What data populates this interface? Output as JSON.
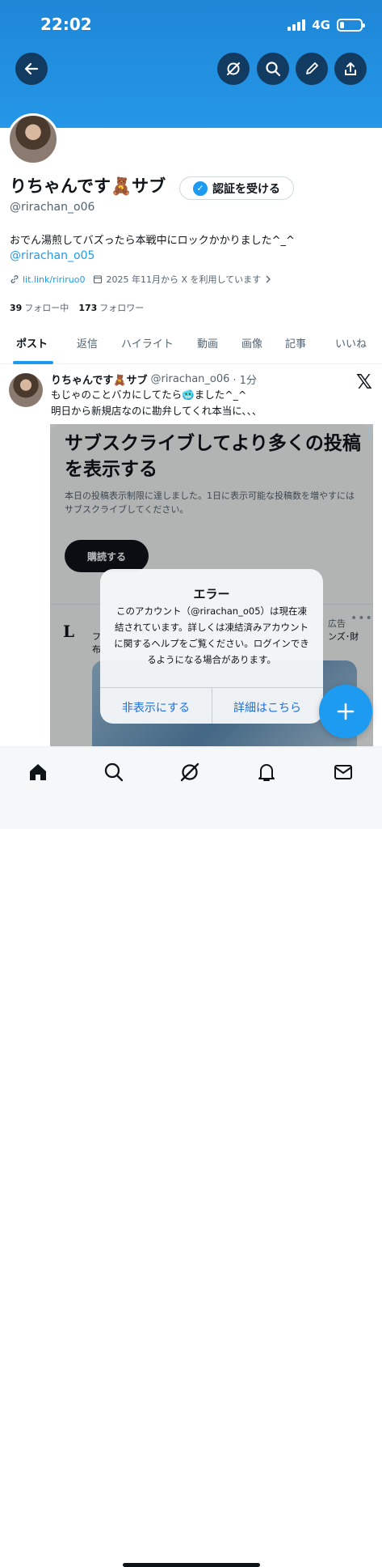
{
  "status": {
    "time": "22:02",
    "network": "4G",
    "battery_level": 0.2
  },
  "header": {
    "back_icon": "arrow-left-icon",
    "actions": [
      "grok-icon",
      "search-icon",
      "edit-icon",
      "share-icon"
    ]
  },
  "profile": {
    "display_name": "りちゃんです🧸サブ",
    "verify_label": "認証を受ける",
    "handle": "@rirachan_o06",
    "bio": "おでん湯煎してバズったら本戦中にロックかかりました^_^",
    "bio_link": "@rirachan_o05",
    "website": "lit.link/ririruo0",
    "joined": "2025 年11月から X を利用しています",
    "following_count": "39",
    "following_label": "フォロー中",
    "followers_count": "173",
    "followers_label": "フォロワー"
  },
  "tabs": [
    "ポスト",
    "返信",
    "ハイライト",
    "動画",
    "画像",
    "記事",
    "いいね"
  ],
  "post": {
    "name": "りちゃんです🧸サブ",
    "handle": "@rirachan_o06",
    "time": "· 1分",
    "line1": "もじゃのことバカにしてたら🥶ました^_^",
    "line2": "明日から新規店なのに勘弁してくれ本当に、、、"
  },
  "subscribe": {
    "title": "サブスクライブしてより多くの投稿を表示する",
    "description": "本日の投稿表示制限に達しました。1日に表示可能な投稿数を増やすにはサブスクライブしてください。",
    "button": "購読する"
  },
  "ad": {
    "brand_initial": "L",
    "prefix_1": "フ",
    "prefix_2": "布",
    "label": "広告",
    "more": "•••",
    "text": "ンズ･財"
  },
  "dialog": {
    "title": "エラー",
    "body": "このアカウント（@rirachan_o05）は現在凍結されています。詳しくは凍結済みアカウントに関するヘルプをご覧ください。ログインできるようになる場合があります。",
    "hide_button": "非表示にする",
    "details_button": "詳細はこちら"
  },
  "nav": [
    "home-icon",
    "search-icon",
    "grok-icon",
    "notifications-icon",
    "messages-icon"
  ],
  "colors": {
    "accent": "#1d9bf0",
    "header": "#2597e8"
  }
}
